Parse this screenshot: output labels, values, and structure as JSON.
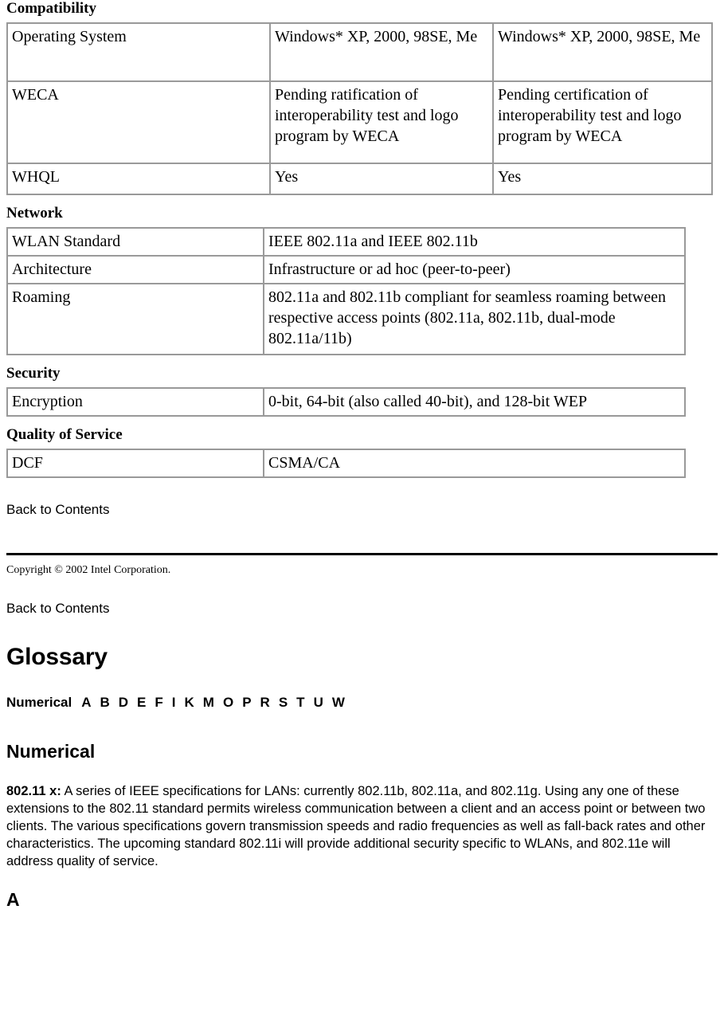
{
  "sections": {
    "compatibility": {
      "heading": "Compatibility",
      "rows": [
        {
          "label": "Operating System",
          "col2": "Windows* XP, 2000, 98SE, Me",
          "col3": "Windows* XP, 2000, 98SE, Me"
        },
        {
          "label": "WECA",
          "col2": "Pending ratification of interoperability test and logo program by WECA",
          "col3": "Pending certification of interoperability test and logo program by WECA"
        },
        {
          "label": "WHQL",
          "col2": "Yes",
          "col3": "Yes"
        }
      ]
    },
    "network": {
      "heading": "Network",
      "rows": [
        {
          "label": "WLAN Standard",
          "value": "IEEE 802.11a and IEEE 802.11b"
        },
        {
          "label": "Architecture",
          "value": "Infrastructure or ad hoc (peer-to-peer)"
        },
        {
          "label": "Roaming",
          "value": "802.11a and 802.11b compliant for seamless roaming between respective access points (802.11a, 802.11b, dual-mode 802.11a/11b)"
        }
      ]
    },
    "security": {
      "heading": "Security",
      "rows": [
        {
          "label": "Encryption",
          "value": "0-bit, 64-bit (also called 40-bit), and 128-bit WEP"
        }
      ]
    },
    "quality_of_service": {
      "heading": "Quality of Service",
      "rows": [
        {
          "label": "DCF",
          "value": "CSMA/CA"
        }
      ]
    }
  },
  "back_to_contents_1": "Back to Contents",
  "copyright": "Copyright © 2002 Intel Corporation.",
  "back_to_contents_2": "Back to Contents",
  "glossary": {
    "title": "Glossary",
    "index": [
      "Numerical",
      "A",
      "B",
      "D",
      "E",
      "F",
      "I",
      "K",
      "M",
      "O",
      "P",
      "R",
      "S",
      "T",
      "U",
      "W"
    ],
    "numerical": {
      "heading": "Numerical",
      "term": "802.11 x:",
      "definition": " A series of IEEE specifications for LANs: currently 802.11b, 802.11a, and 802.11g. Using any one of these extensions to the 802.11 standard permits wireless communication between a client and an access point or between two clients. The various specifications govern transmission speeds and radio frequencies as well as fall-back rates and other characteristics. The upcoming standard 802.11i will provide additional security specific to WLANs, and 802.11e will address quality of service."
    },
    "a_heading": "A"
  }
}
